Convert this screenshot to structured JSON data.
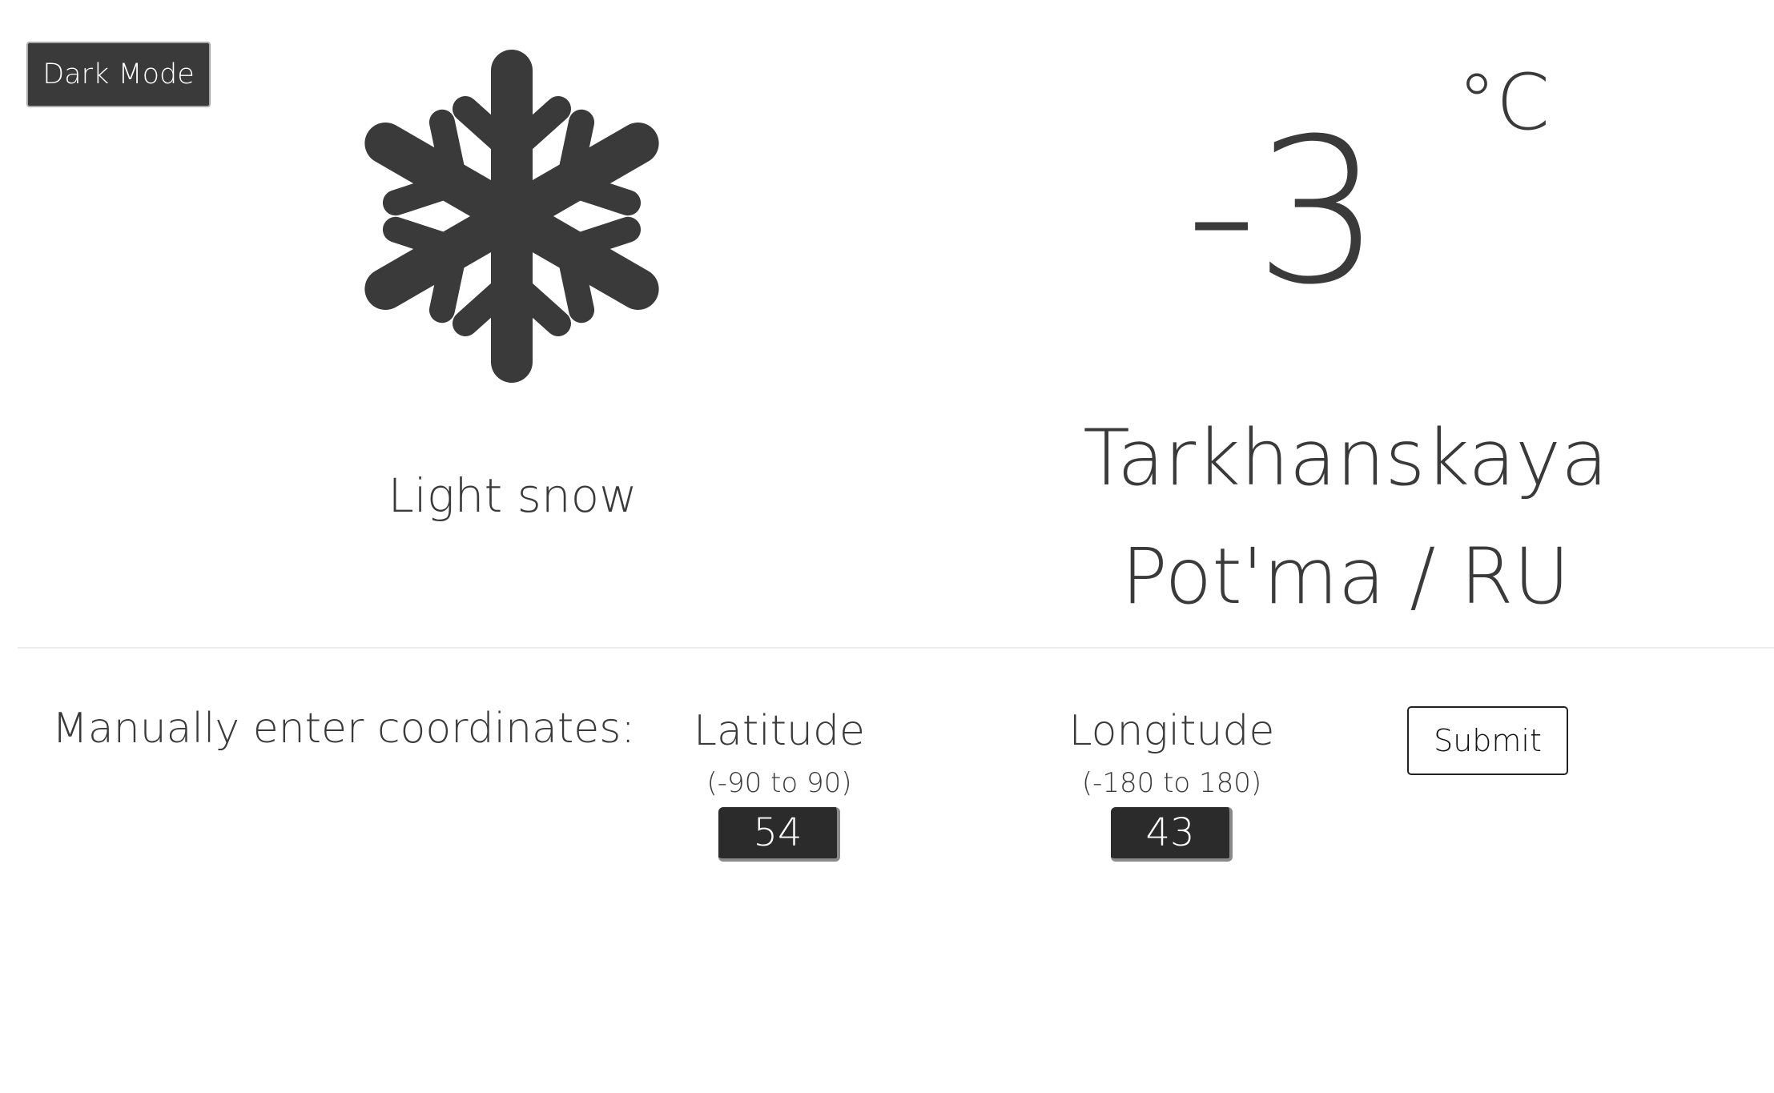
{
  "header": {
    "dark_mode_label": "Dark Mode"
  },
  "weather": {
    "icon": "snowflake-icon",
    "condition": "Light snow",
    "temperature": "-3",
    "unit": "°C",
    "location": "Tarkhanskaya Pot'ma / RU"
  },
  "coordinates": {
    "prompt": "Manually enter coordinates:",
    "latitude": {
      "label": "Latitude",
      "range": "(-90 to 90)",
      "value": "54"
    },
    "longitude": {
      "label": "Longitude",
      "range": "(-180 to 180)",
      "value": "43"
    },
    "submit_label": "Submit"
  },
  "colors": {
    "text": "#393939",
    "button_dark": "#3a3a3a",
    "input_bg": "#2b2b2b",
    "background": "#ffffff"
  }
}
